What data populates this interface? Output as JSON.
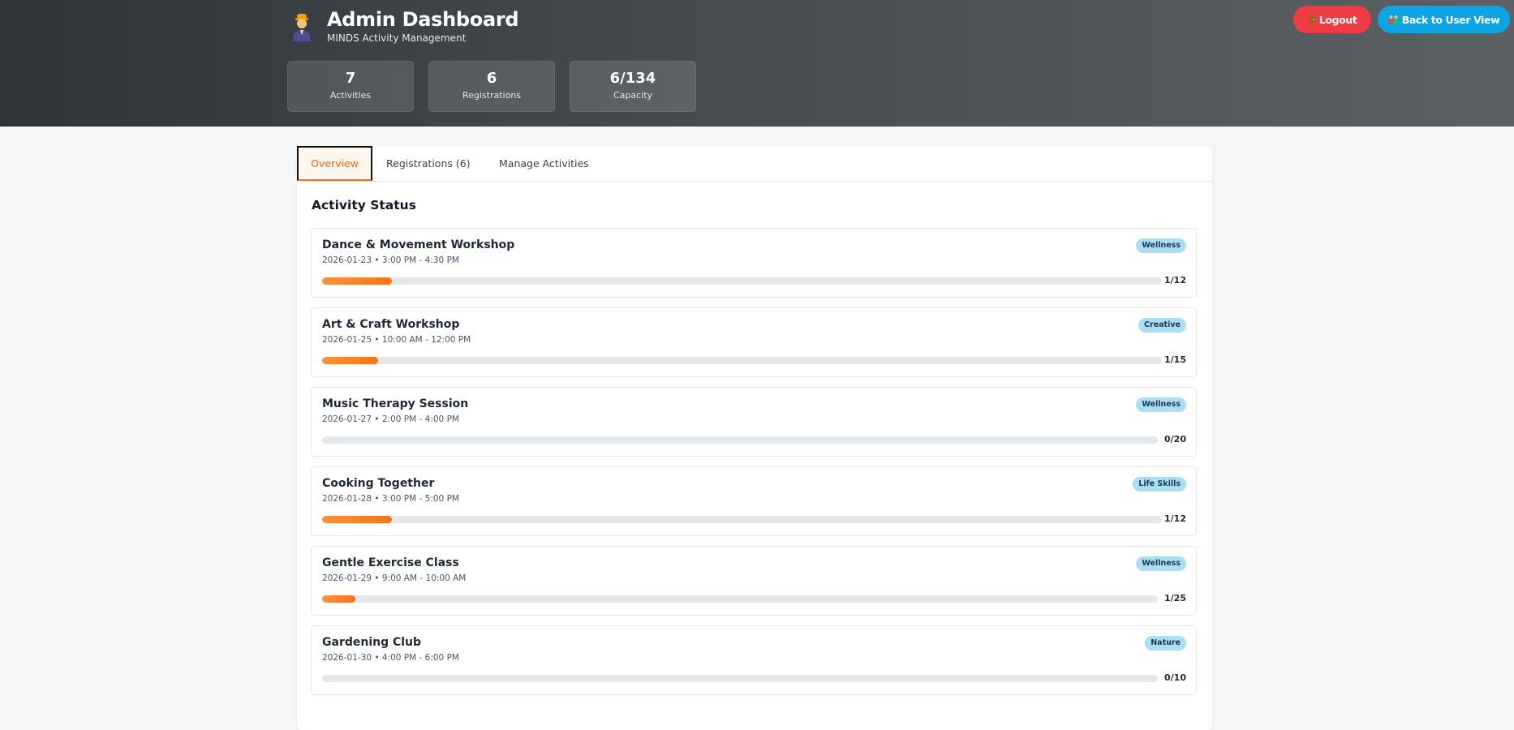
{
  "header": {
    "title": "Admin Dashboard",
    "subtitle": "MINDS Activity Management",
    "logout_label": "Logout",
    "back_label": "Back to User View",
    "logout_icon": "door-icon",
    "back_icon": "family-icon"
  },
  "stats": [
    {
      "value": "7",
      "label": "Activities"
    },
    {
      "value": "6",
      "label": "Registrations"
    },
    {
      "value": "6/134",
      "label": "Capacity"
    }
  ],
  "tabs": [
    {
      "label": "Overview",
      "active": true
    },
    {
      "label": "Registrations (6)",
      "active": false
    },
    {
      "label": "Manage Activities",
      "active": false
    }
  ],
  "section_title": "Activity Status",
  "activities": [
    {
      "name": "Dance & Movement Workshop",
      "time": "2026-01-23 • 3:00 PM - 4:30 PM",
      "category": "Wellness",
      "registered": 1,
      "capacity": 12,
      "count_label": "1/12"
    },
    {
      "name": "Art & Craft Workshop",
      "time": "2026-01-25 • 10:00 AM - 12:00 PM",
      "category": "Creative",
      "registered": 1,
      "capacity": 15,
      "count_label": "1/15"
    },
    {
      "name": "Music Therapy Session",
      "time": "2026-01-27 • 2:00 PM - 4:00 PM",
      "category": "Wellness",
      "registered": 0,
      "capacity": 20,
      "count_label": "0/20"
    },
    {
      "name": "Cooking Together",
      "time": "2026-01-28 • 3:00 PM - 5:00 PM",
      "category": "Life Skills",
      "registered": 1,
      "capacity": 12,
      "count_label": "1/12"
    },
    {
      "name": "Gentle Exercise Class",
      "time": "2026-01-29 • 9:00 AM - 10:00 AM",
      "category": "Wellness",
      "registered": 1,
      "capacity": 25,
      "count_label": "1/25"
    },
    {
      "name": "Gardening Club",
      "time": "2026-01-30 • 4:00 PM - 6:00 PM",
      "category": "Nature",
      "registered": 0,
      "capacity": 10,
      "count_label": "0/10"
    }
  ],
  "colors": {
    "accent": "#f97316",
    "logout": "#ef3b44",
    "back": "#0ba5e6",
    "badge": "#a9def5"
  }
}
